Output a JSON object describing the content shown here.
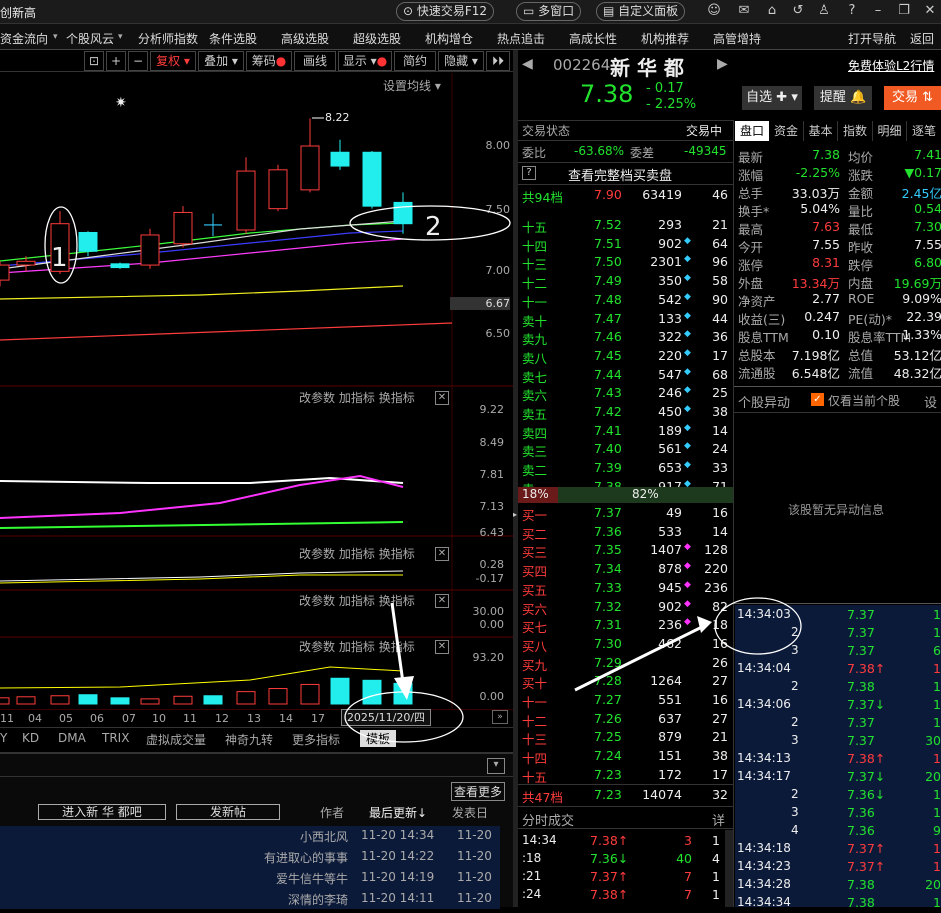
{
  "title_bar": {
    "left_text": "创新高",
    "quick_trade": "快速交易F12",
    "multi_window": "多窗口",
    "custom_panel": "自定义面板"
  },
  "menu": [
    "资金流向",
    "个股风云",
    "分析师指数",
    "条件选股",
    "高级选股",
    "超级选股",
    "机构增仓",
    "热点追击",
    "高成长性",
    "机构推荐",
    "高管增持",
    "打开导航",
    "返回"
  ],
  "toolbar": {
    "restore": "复权",
    "overlay": "叠加",
    "chips": "筹码",
    "draw": "画线",
    "display": "显示",
    "simple": "简约",
    "hide": "隐藏",
    "ma_setting": "设置均线"
  },
  "price_axis": [
    "8.00",
    "7.50",
    "7.00",
    "6.67",
    "6.50"
  ],
  "annotations": {
    "high": "8.22",
    "circle1": "1",
    "circle2": "2"
  },
  "panels": [
    {
      "controls": [
        "改参数",
        "加指标",
        "换指标"
      ],
      "axis": [
        "9.22",
        "8.49",
        "7.81",
        "7.13",
        "6.43"
      ]
    },
    {
      "controls": [
        "改参数",
        "加指标",
        "换指标"
      ],
      "axis": [
        "0.28",
        "-0.17"
      ]
    },
    {
      "controls": [
        "改参数",
        "加指标",
        "换指标"
      ],
      "axis": [
        "30.00",
        "0.00"
      ]
    },
    {
      "controls": [
        "改参数",
        "加指标",
        "换指标"
      ],
      "axis": [
        "93.20",
        "0.00"
      ]
    }
  ],
  "x_axis": [
    "11",
    "04",
    "05",
    "06",
    "07",
    "10",
    "11",
    "12",
    "13",
    "14",
    "17"
  ],
  "date_badge": "2025/11/20/四",
  "indicator_tabs": [
    "Y",
    "KD",
    "DMA",
    "TRIX",
    "虚拟成交量",
    "神奇九转",
    "更多指标",
    "模板"
  ],
  "forum": {
    "view_more": "查看更多",
    "enter_bar": "进入新 华 都吧",
    "post": "发新帖",
    "col_author": "作者",
    "col_last": "最后更新",
    "col_post": "发表日",
    "rows": [
      {
        "author": "小西北风",
        "last": "11-20 14:34",
        "post": "11-20"
      },
      {
        "author": "有进取心的事事",
        "last": "11-20 14:22",
        "post": "11-20"
      },
      {
        "author": "爱牛信牛等牛",
        "last": "11-20 14:19",
        "post": "11-20"
      },
      {
        "author": "深情的李琦",
        "last": "11-20 14:11",
        "post": "11-20"
      }
    ]
  },
  "stock": {
    "code": "002264",
    "name": "新 华 都",
    "price": "7.38",
    "change": "- 0.17",
    "pct": "- 2.25%",
    "watch": "自选",
    "alert": "提醒",
    "trade": "交易",
    "l2": "免费体验L2行情"
  },
  "status": {
    "label": "交易状态",
    "value": "交易中",
    "wb_label": "委比",
    "wb": "-63.68%",
    "wc_label": "委差",
    "wc": "-49345",
    "full": "查看完整档买卖盘",
    "q": "?"
  },
  "sell_total": {
    "label": "共94档",
    "price": "7.90",
    "vol": "63419",
    "n": "46"
  },
  "asks": [
    {
      "l": "十五",
      "p": "7.52",
      "v": "293",
      "d": "",
      "n": "21"
    },
    {
      "l": "十四",
      "p": "7.51",
      "v": "902",
      "d": "c",
      "n": "64"
    },
    {
      "l": "十三",
      "p": "7.50",
      "v": "2301",
      "d": "c",
      "n": "96"
    },
    {
      "l": "十二",
      "p": "7.49",
      "v": "350",
      "d": "c",
      "n": "58"
    },
    {
      "l": "十一",
      "p": "7.48",
      "v": "542",
      "d": "c",
      "n": "90"
    },
    {
      "l": "卖十",
      "p": "7.47",
      "v": "133",
      "d": "c",
      "n": "44"
    },
    {
      "l": "卖九",
      "p": "7.46",
      "v": "322",
      "d": "c",
      "n": "36"
    },
    {
      "l": "卖八",
      "p": "7.45",
      "v": "220",
      "d": "c",
      "n": "17"
    },
    {
      "l": "卖七",
      "p": "7.44",
      "v": "547",
      "d": "c",
      "n": "68"
    },
    {
      "l": "卖六",
      "p": "7.43",
      "v": "246",
      "d": "c",
      "n": "25"
    },
    {
      "l": "卖五",
      "p": "7.42",
      "v": "450",
      "d": "c",
      "n": "38"
    },
    {
      "l": "卖四",
      "p": "7.41",
      "v": "189",
      "d": "c",
      "n": "14"
    },
    {
      "l": "卖三",
      "p": "7.40",
      "v": "561",
      "d": "c",
      "n": "24"
    },
    {
      "l": "卖二",
      "p": "7.39",
      "v": "653",
      "d": "c",
      "n": "33"
    },
    {
      "l": "卖一",
      "p": "7.38",
      "v": "917",
      "d": "c",
      "n": "71"
    }
  ],
  "ratio": {
    "left": "18%",
    "right": "82%"
  },
  "bids": [
    {
      "l": "买一",
      "p": "7.37",
      "v": "49",
      "d": "",
      "n": "16"
    },
    {
      "l": "买二",
      "p": "7.36",
      "v": "533",
      "d": "",
      "n": "14"
    },
    {
      "l": "买三",
      "p": "7.35",
      "v": "1407",
      "d": "m",
      "n": "128"
    },
    {
      "l": "买四",
      "p": "7.34",
      "v": "878",
      "d": "m",
      "n": "220"
    },
    {
      "l": "买五",
      "p": "7.33",
      "v": "945",
      "d": "m",
      "n": "236"
    },
    {
      "l": "买六",
      "p": "7.32",
      "v": "902",
      "d": "m",
      "n": "82"
    },
    {
      "l": "买七",
      "p": "7.31",
      "v": "236",
      "d": "m",
      "n": "18"
    },
    {
      "l": "买八",
      "p": "7.30",
      "v": "462",
      "d": "",
      "n": "16"
    },
    {
      "l": "买九",
      "p": "7.29",
      "v": "",
      "d": "",
      "n": "26"
    },
    {
      "l": "买十",
      "p": "7.28",
      "v": "1264",
      "d": "",
      "n": "27"
    },
    {
      "l": "十一",
      "p": "7.27",
      "v": "551",
      "d": "",
      "n": "16"
    },
    {
      "l": "十二",
      "p": "7.26",
      "v": "637",
      "d": "",
      "n": "27"
    },
    {
      "l": "十三",
      "p": "7.25",
      "v": "879",
      "d": "",
      "n": "21"
    },
    {
      "l": "十四",
      "p": "7.24",
      "v": "151",
      "d": "",
      "n": "38"
    },
    {
      "l": "十五",
      "p": "7.23",
      "v": "172",
      "d": "",
      "n": "17"
    }
  ],
  "buy_total": {
    "label": "共47档",
    "price": "7.23",
    "vol": "14074",
    "n": "32"
  },
  "tick_header": {
    "label": "分时成交",
    "detail": "详"
  },
  "ticks": [
    {
      "t": "14:34",
      "p": "7.38",
      "a": "↑",
      "v": "3",
      "n": "1"
    },
    {
      "t": ":18",
      "p": "7.36",
      "a": "↓",
      "v": "40",
      "n": "4"
    },
    {
      "t": ":21",
      "p": "7.37",
      "a": "↑",
      "v": "7",
      "n": "1"
    },
    {
      "t": ":24",
      "p": "7.38",
      "a": "↑",
      "v": "7",
      "n": "1"
    }
  ],
  "tabs": [
    "盘口",
    "资金",
    "基本",
    "指数",
    "明细",
    "逐笔"
  ],
  "stats": [
    [
      "最新",
      "7.38",
      "均价",
      "7.41"
    ],
    [
      "涨幅",
      "-2.25%",
      "涨跌",
      "▼0.17"
    ],
    [
      "总手",
      "33.03万",
      "金额",
      "2.45亿"
    ],
    [
      "换手*",
      "5.04%",
      "量比",
      "0.54"
    ],
    [
      "最高",
      "7.63",
      "最低",
      "7.30"
    ],
    [
      "今开",
      "7.55",
      "昨收",
      "7.55"
    ],
    [
      "涨停",
      "8.31",
      "跌停",
      "6.80"
    ],
    [
      "外盘",
      "13.34万",
      "内盘",
      "19.69万"
    ],
    [
      "净资产",
      "2.77",
      "ROE",
      "9.09%"
    ],
    [
      "收益(三)",
      "0.247",
      "PE(动)*",
      "22.39"
    ],
    [
      "股息TTM",
      "0.10",
      "股息率TTM",
      "1.33%"
    ],
    [
      "总股本",
      "7.198亿",
      "总值",
      "53.12亿"
    ],
    [
      "流通股",
      "6.548亿",
      "流值",
      "48.32亿"
    ]
  ],
  "anomaly": {
    "title": "个股异动",
    "check": "仅看当前个股",
    "settings": "设",
    "empty": "该股暂无异动信息"
  },
  "trades": [
    {
      "t": "14:34:03",
      "p": "7.37",
      "a": "",
      "v": "1"
    },
    {
      "t": "2",
      "p": "7.37",
      "a": "",
      "v": "1"
    },
    {
      "t": "3",
      "p": "7.37",
      "a": "",
      "v": "6"
    },
    {
      "t": "14:34:04",
      "p": "7.38",
      "a": "↑",
      "v": "1"
    },
    {
      "t": "2",
      "p": "7.38",
      "a": "",
      "v": "1"
    },
    {
      "t": "14:34:06",
      "p": "7.37",
      "a": "↓",
      "v": "1"
    },
    {
      "t": "2",
      "p": "7.37",
      "a": "",
      "v": "1"
    },
    {
      "t": "3",
      "p": "7.37",
      "a": "",
      "v": "30"
    },
    {
      "t": "14:34:13",
      "p": "7.38",
      "a": "↑",
      "v": "1"
    },
    {
      "t": "14:34:17",
      "p": "7.37",
      "a": "↓",
      "v": "20"
    },
    {
      "t": "2",
      "p": "7.36",
      "a": "↓",
      "v": "1"
    },
    {
      "t": "3",
      "p": "7.36",
      "a": "",
      "v": "1"
    },
    {
      "t": "4",
      "p": "7.36",
      "a": "",
      "v": "9"
    },
    {
      "t": "14:34:18",
      "p": "7.37",
      "a": "↑",
      "v": "1"
    },
    {
      "t": "14:34:23",
      "p": "7.37",
      "a": "↑",
      "v": "1"
    },
    {
      "t": "14:34:28",
      "p": "7.38",
      "a": "",
      "v": "20"
    },
    {
      "t": "14:34:34",
      "p": "7.38",
      "a": "",
      "v": "1"
    }
  ],
  "chart_data": {
    "type": "candlestick",
    "x_ticks": [
      "11",
      "04",
      "05",
      "06",
      "07",
      "10",
      "11",
      "12",
      "13",
      "14",
      "17"
    ],
    "ylim": [
      6.3,
      8.3
    ],
    "candles": [
      {
        "o": 6.93,
        "c": 7.05,
        "h": 7.08,
        "l": 6.88,
        "dir": "up"
      },
      {
        "o": 7.05,
        "c": 7.08,
        "h": 7.12,
        "l": 7.0,
        "dir": "up"
      },
      {
        "o": 7.0,
        "c": 7.38,
        "h": 7.48,
        "l": 6.98,
        "dir": "up"
      },
      {
        "o": 7.31,
        "c": 7.16,
        "h": 7.32,
        "l": 7.12,
        "dir": "down"
      },
      {
        "o": 7.06,
        "c": 7.03,
        "h": 7.07,
        "l": 7.02,
        "dir": "down"
      },
      {
        "o": 7.05,
        "c": 7.29,
        "h": 7.34,
        "l": 7.02,
        "dir": "up"
      },
      {
        "o": 7.22,
        "c": 7.47,
        "h": 7.52,
        "l": 7.19,
        "dir": "up"
      },
      {
        "o": 7.37,
        "c": 7.37,
        "h": 7.46,
        "l": 7.28,
        "dir": "flat"
      },
      {
        "o": 7.33,
        "c": 7.8,
        "h": 7.91,
        "l": 7.3,
        "dir": "up"
      },
      {
        "o": 7.5,
        "c": 7.81,
        "h": 7.85,
        "l": 7.48,
        "dir": "up"
      },
      {
        "o": 7.65,
        "c": 8.0,
        "h": 8.22,
        "l": 7.63,
        "dir": "up"
      },
      {
        "o": 7.95,
        "c": 7.84,
        "h": 8.05,
        "l": 7.81,
        "dir": "down"
      },
      {
        "o": 7.95,
        "c": 7.52,
        "h": 7.96,
        "l": 7.5,
        "dir": "down"
      },
      {
        "o": 7.55,
        "c": 7.38,
        "h": 7.63,
        "l": 7.3,
        "dir": "down"
      }
    ],
    "volumes": [
      12,
      14,
      16,
      18,
      12,
      10,
      15,
      16,
      24,
      30,
      38,
      50,
      46,
      40,
      28
    ]
  }
}
